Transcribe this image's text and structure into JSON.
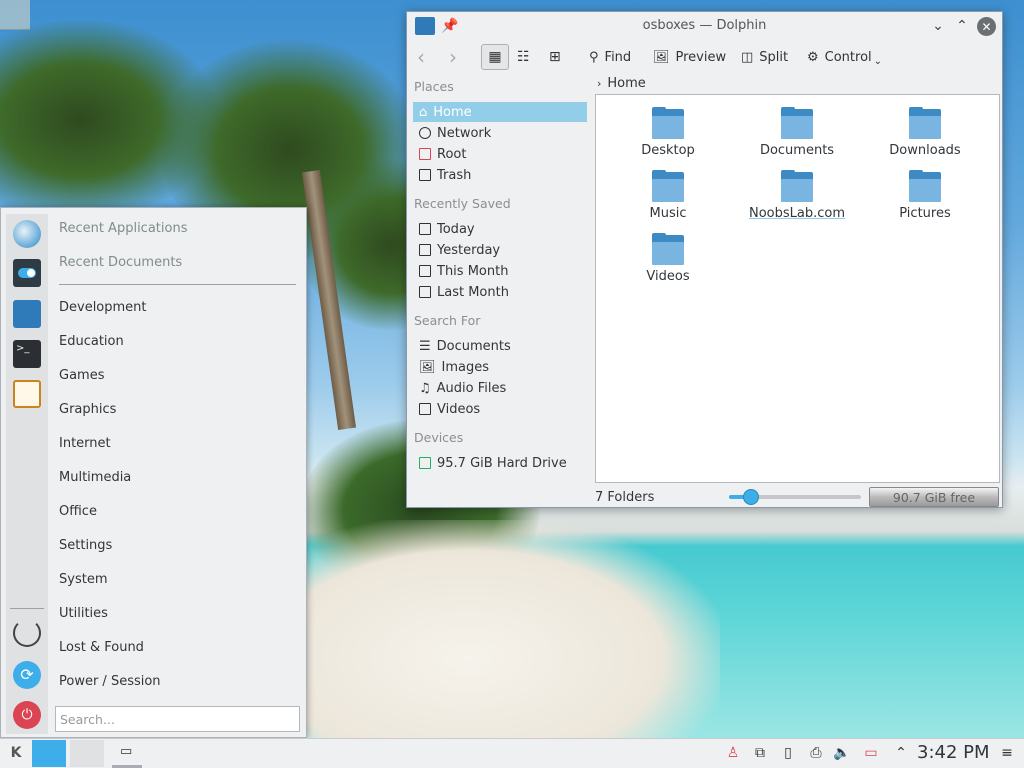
{
  "dolphin": {
    "title": "osboxes — Dolphin",
    "toolbar": {
      "find": "Find",
      "preview": "Preview",
      "split": "Split",
      "control": "Control"
    },
    "breadcrumb": "Home",
    "places": {
      "places_header": "Places",
      "places_items": [
        "Home",
        "Network",
        "Root",
        "Trash"
      ],
      "recent_header": "Recently Saved",
      "recent_items": [
        "Today",
        "Yesterday",
        "This Month",
        "Last Month"
      ],
      "search_header": "Search For",
      "search_items": [
        "Documents",
        "Images",
        "Audio Files",
        "Videos"
      ],
      "devices_header": "Devices",
      "devices_items": [
        "95.7 GiB Hard Drive"
      ]
    },
    "folders": [
      "Desktop",
      "Documents",
      "Downloads",
      "Music",
      "NoobsLab.com",
      "Pictures",
      "Videos"
    ],
    "status": {
      "count": "7 Folders",
      "free": "90.7 GiB free"
    },
    "zoom_fraction": 0.17
  },
  "launcher": {
    "recent_apps": "Recent Applications",
    "recent_docs": "Recent Documents",
    "categories": [
      "Development",
      "Education",
      "Games",
      "Graphics",
      "Internet",
      "Multimedia",
      "Office",
      "Settings",
      "System",
      "Utilities",
      "Lost & Found",
      "Power / Session"
    ],
    "search_placeholder": "Search..."
  },
  "taskbar": {
    "clock": "3:42 PM"
  },
  "colors": {
    "selection": "#93cee9",
    "accent": "#3daee9",
    "folder": "#79b5e0"
  }
}
